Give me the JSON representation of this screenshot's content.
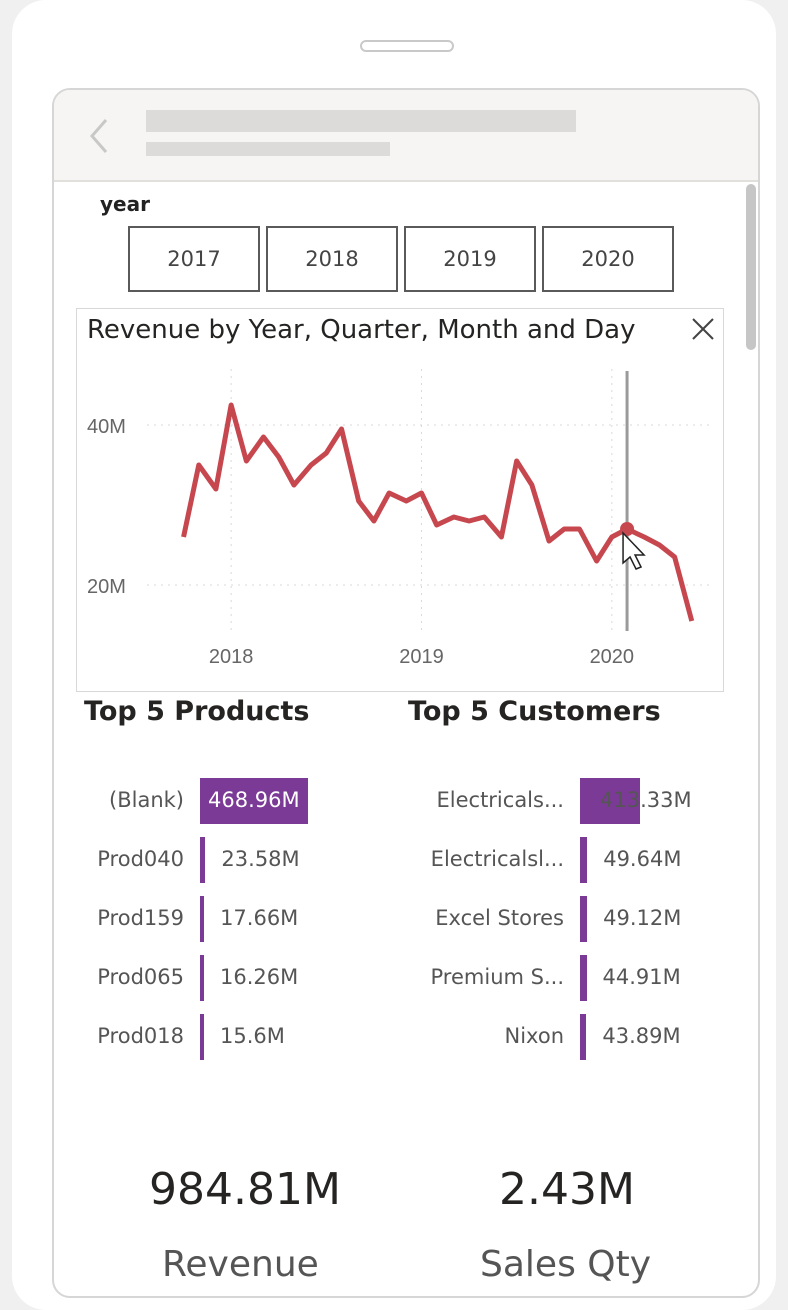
{
  "slicer": {
    "label": "year",
    "options": [
      "2017",
      "2018",
      "2019",
      "2020"
    ]
  },
  "revenue_chart": {
    "title": "Revenue by Year, Quarter, Month and Day",
    "chart_data": {
      "type": "line",
      "title": "Revenue by Year, Quarter, Month and Day",
      "x_ticks": [
        "2018",
        "2019",
        "2020"
      ],
      "y_ticks": [
        "20M",
        "40M"
      ],
      "ylim": [
        15,
        47
      ],
      "series": [
        {
          "color": "#c7474f",
          "x": [
            2017.75,
            2017.83,
            2017.92,
            2018.0,
            2018.08,
            2018.17,
            2018.25,
            2018.33,
            2018.42,
            2018.5,
            2018.58,
            2018.67,
            2018.75,
            2018.83,
            2018.92,
            2019.0,
            2019.08,
            2019.17,
            2019.25,
            2019.33,
            2019.42,
            2019.5,
            2019.58,
            2019.67,
            2019.75,
            2019.83,
            2019.92,
            2020.0,
            2020.08,
            2020.17,
            2020.25,
            2020.33,
            2020.42
          ],
          "y": [
            26,
            35,
            32,
            42.5,
            35.5,
            38.5,
            36,
            32.5,
            35,
            36.5,
            39.5,
            30.5,
            28,
            31.5,
            30.5,
            31.5,
            27.5,
            28.5,
            28,
            28.5,
            26,
            35.5,
            32.5,
            25.5,
            27,
            27,
            23,
            26,
            27,
            26,
            25,
            23.5,
            15.5
          ]
        }
      ],
      "highlight": {
        "x": 2020.08,
        "y": 27
      }
    }
  },
  "top_products": {
    "title": "Top 5 Products",
    "items": [
      {
        "label": "(Blank)",
        "value": 468.96,
        "value_label": "468.96M"
      },
      {
        "label": "Prod040",
        "value": 23.58,
        "value_label": "23.58M"
      },
      {
        "label": "Prod159",
        "value": 17.66,
        "value_label": "17.66M"
      },
      {
        "label": "Prod065",
        "value": 16.26,
        "value_label": "16.26M"
      },
      {
        "label": "Prod018",
        "value": 15.6,
        "value_label": "15.6M"
      }
    ]
  },
  "top_customers": {
    "title": "Top 5 Customers",
    "items": [
      {
        "label": "Electricals...",
        "value": 413.33,
        "value_label": "413.33M"
      },
      {
        "label": "Electricalsl...",
        "value": 49.64,
        "value_label": "49.64M"
      },
      {
        "label": "Excel Stores",
        "value": 49.12,
        "value_label": "49.12M"
      },
      {
        "label": "Premium S...",
        "value": 44.91,
        "value_label": "44.91M"
      },
      {
        "label": "Nixon",
        "value": 43.89,
        "value_label": "43.89M"
      }
    ]
  },
  "kpis": {
    "revenue": {
      "value": "984.81M",
      "label": "Revenue"
    },
    "sales_qty": {
      "value": "2.43M",
      "label": "Sales Qty"
    }
  },
  "colors": {
    "bar": "#7b3a96",
    "line": "#c7474f"
  }
}
